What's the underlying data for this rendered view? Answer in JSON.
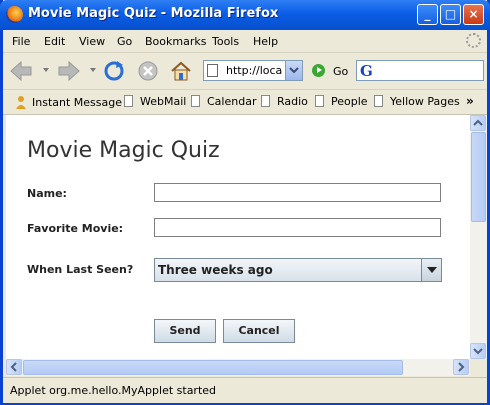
{
  "window": {
    "title": "Movie Magic Quiz - Mozilla Firefox",
    "minimize": "_",
    "maximize": "□",
    "close": "×"
  },
  "menubar": {
    "items": [
      {
        "label": "File"
      },
      {
        "label": "Edit"
      },
      {
        "label": "View"
      },
      {
        "label": "Go"
      },
      {
        "label": "Bookmarks"
      },
      {
        "label": "Tools"
      },
      {
        "label": "Help"
      }
    ]
  },
  "navigation": {
    "url": "http://local",
    "go_label": "Go",
    "search_engine_glyph": "G"
  },
  "bookmarks_toolbar": {
    "items": [
      {
        "label": "Instant Message"
      },
      {
        "label": "WebMail"
      },
      {
        "label": "Calendar"
      },
      {
        "label": "Radio"
      },
      {
        "label": "People"
      },
      {
        "label": "Yellow Pages"
      }
    ],
    "more": "»"
  },
  "applet": {
    "title": "Movie Magic Quiz",
    "name_label": "Name:",
    "name_value": "",
    "movie_label": "Favorite Movie:",
    "movie_value": "",
    "last_seen_label": "When Last Seen?",
    "last_seen_value": "Three weeks ago",
    "send_label": "Send",
    "cancel_label": "Cancel"
  },
  "status": {
    "text": "Applet org.me.hello.MyApplet started"
  }
}
